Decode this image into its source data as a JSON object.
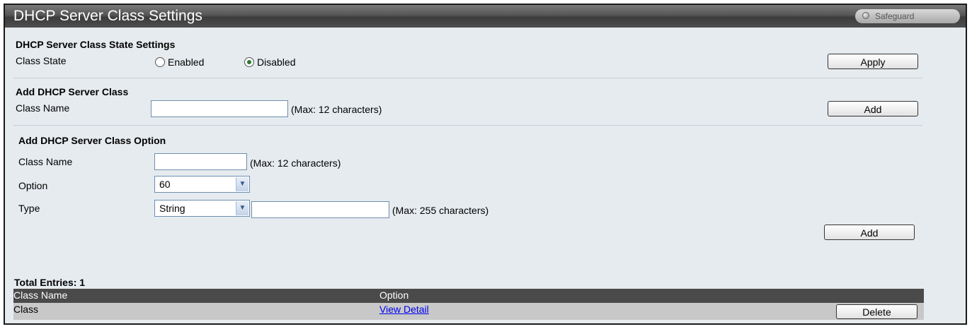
{
  "header": {
    "title": "DHCP Server Class Settings",
    "safeguard": "Safeguard"
  },
  "state_section": {
    "heading": "DHCP Server Class State Settings",
    "label": "Class State",
    "options": [
      "Enabled",
      "Disabled"
    ],
    "selected": "Disabled",
    "apply_label": "Apply"
  },
  "add_class_section": {
    "heading": "Add DHCP Server Class",
    "label": "Class Name",
    "value": "",
    "hint": "(Max: 12 characters)",
    "add_label": "Add"
  },
  "add_option_section": {
    "heading": "Add DHCP Server Class Option",
    "class_name_label": "Class Name",
    "class_name_value": "",
    "class_name_hint": "(Max: 12 characters)",
    "option_label": "Option",
    "option_value": "60",
    "type_label": "Type",
    "type_value": "String",
    "type_input_value": "",
    "type_hint": "(Max: 255 characters)",
    "add_label": "Add"
  },
  "table": {
    "total_entries": "Total Entries: 1",
    "columns": [
      "Class Name",
      "Option"
    ],
    "rows": [
      {
        "class_name": "Class",
        "option_link": "View Detail",
        "delete_label": "Delete"
      }
    ]
  },
  "colors": {
    "title_bar": "#4e4e4e",
    "panel_bg": "#e6ebef",
    "table_header": "#4a4a4a",
    "table_row": "#c8c8c8"
  }
}
